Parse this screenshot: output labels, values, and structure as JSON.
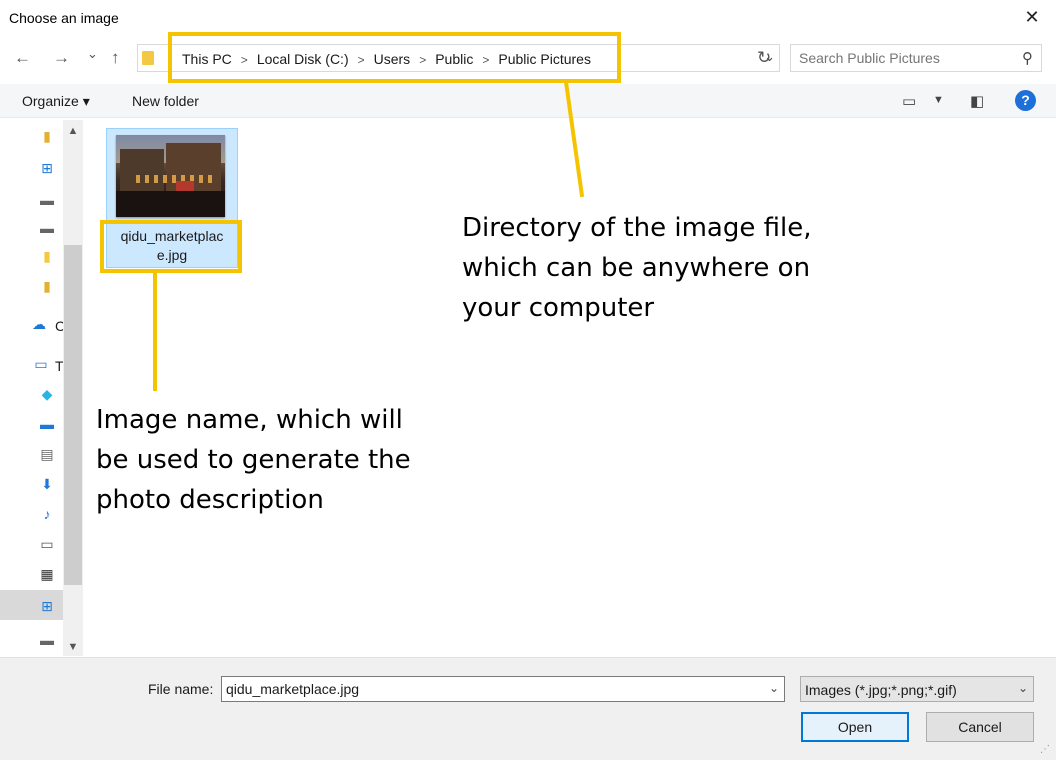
{
  "window": {
    "title": "Choose an image"
  },
  "nav": {
    "back": "←",
    "forward": "→",
    "recent": "⌄",
    "up": "↑",
    "breadcrumbs": [
      "This PC",
      "Local Disk (C:)",
      "Users",
      "Public",
      "Public Pictures"
    ],
    "search_placeholder": "Search Public Pictures"
  },
  "toolbar": {
    "organize_label": "Organize ▾",
    "new_folder_label": "New folder",
    "help": "?"
  },
  "sidebar": {
    "partial_labels": [
      "C",
      "T"
    ]
  },
  "files": [
    {
      "name": "qidu_marketplace.jpg",
      "display_name": "qidu_marketplace.jpg",
      "selected": true
    }
  ],
  "annotations": {
    "directory": "Directory of the image file,\nwhich can be anywhere on\nyour computer",
    "image_name": "Image name, which will\nbe used to generate the\nphoto description"
  },
  "bottom": {
    "file_name_label": "File name:",
    "file_name_value": "qidu_marketplace.jpg",
    "file_type": "Images (*.jpg;*.png;*.gif)",
    "open_label": "Open",
    "cancel_label": "Cancel"
  },
  "colors": {
    "highlight": "#f5c400",
    "selection": "#cce8ff",
    "accent": "#0078d7"
  }
}
